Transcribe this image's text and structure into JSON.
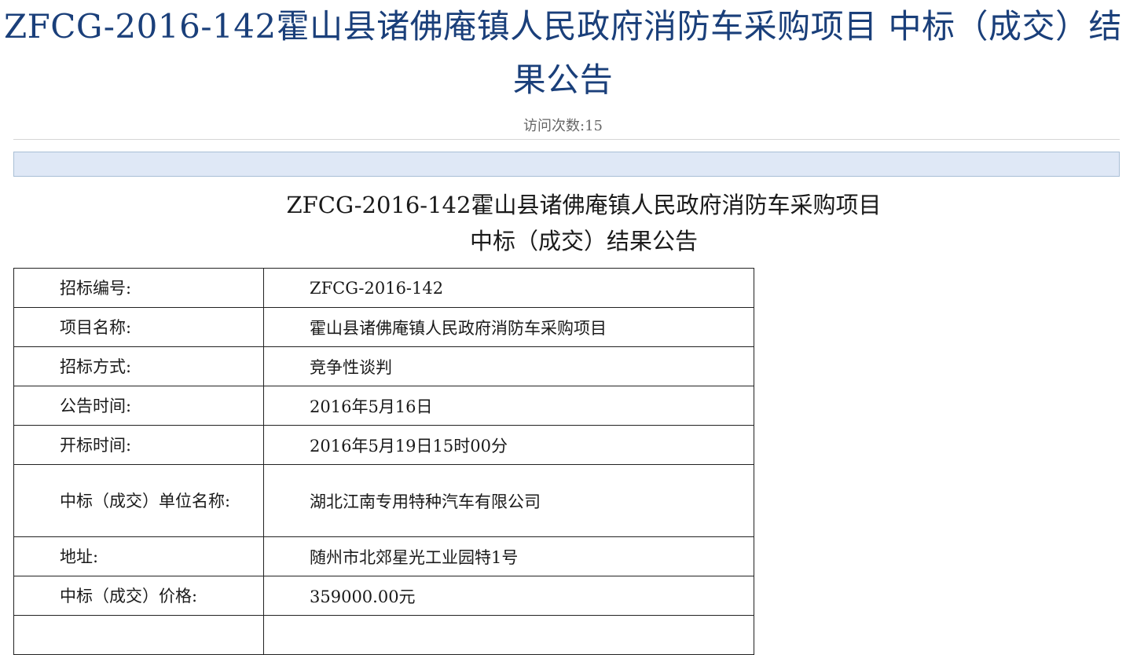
{
  "page": {
    "title": "ZFCG-2016-142霍山县诸佛庵镇人民政府消防车采购项目 中标（成交）结果公告",
    "visit_count": "访问次数:15"
  },
  "document": {
    "title_line1": "ZFCG-2016-142霍山县诸佛庵镇人民政府消防车采购项目",
    "title_line2": "中标（成交）结果公告"
  },
  "table": {
    "rows": [
      {
        "label": "招标编号:",
        "value": "ZFCG-2016-142"
      },
      {
        "label": "项目名称:",
        "value": "霍山县诸佛庵镇人民政府消防车采购项目"
      },
      {
        "label": "招标方式:",
        "value": "竞争性谈判"
      },
      {
        "label": "公告时间:",
        "value": "2016年5月16日"
      },
      {
        "label": "开标时间:",
        "value": "2016年5月19日15时00分"
      },
      {
        "label": "中标（成交）单位名称:",
        "value": "湖北江南专用特种汽车有限公司"
      },
      {
        "label": "地址:",
        "value": "随州市北郊星光工业园特1号"
      },
      {
        "label": "中标（成交）价格:",
        "value": "359000.00元"
      },
      {
        "label": "",
        "value": ""
      }
    ]
  }
}
